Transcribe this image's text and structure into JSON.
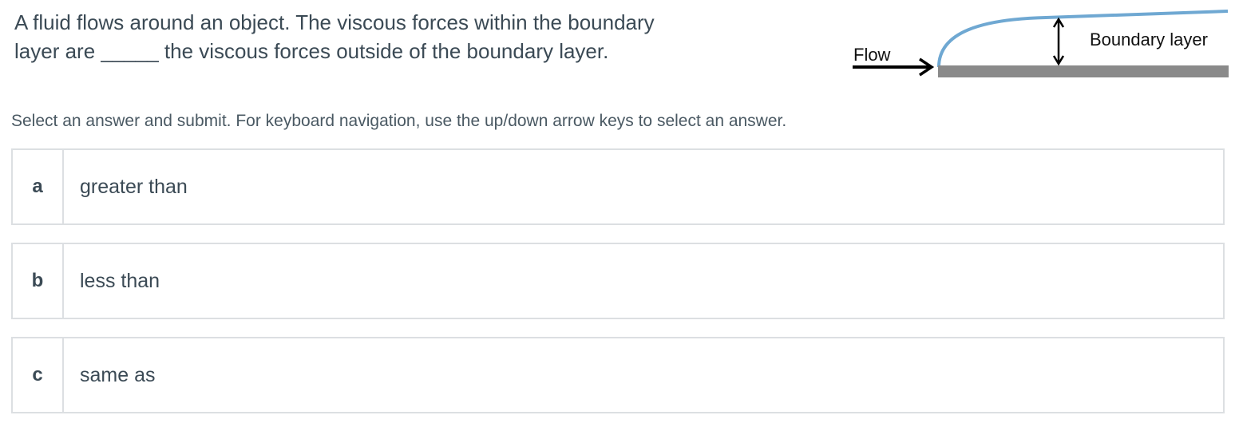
{
  "question": {
    "text": "A fluid flows around an object. The viscous forces within the boundary layer are _____ the viscous forces outside of the boundary layer."
  },
  "diagram": {
    "flow_label": "Flow",
    "boundary_label": "Boundary layer",
    "colors": {
      "boundary_curve": "#6fa8d2",
      "plate": "#8a8a8a",
      "arrows": "#000000"
    }
  },
  "instructions": "Select an answer and submit. For keyboard navigation, use the up/down arrow keys to select an answer.",
  "choices": [
    {
      "letter": "a",
      "text": "greater than"
    },
    {
      "letter": "b",
      "text": "less than"
    },
    {
      "letter": "c",
      "text": "same as"
    }
  ]
}
